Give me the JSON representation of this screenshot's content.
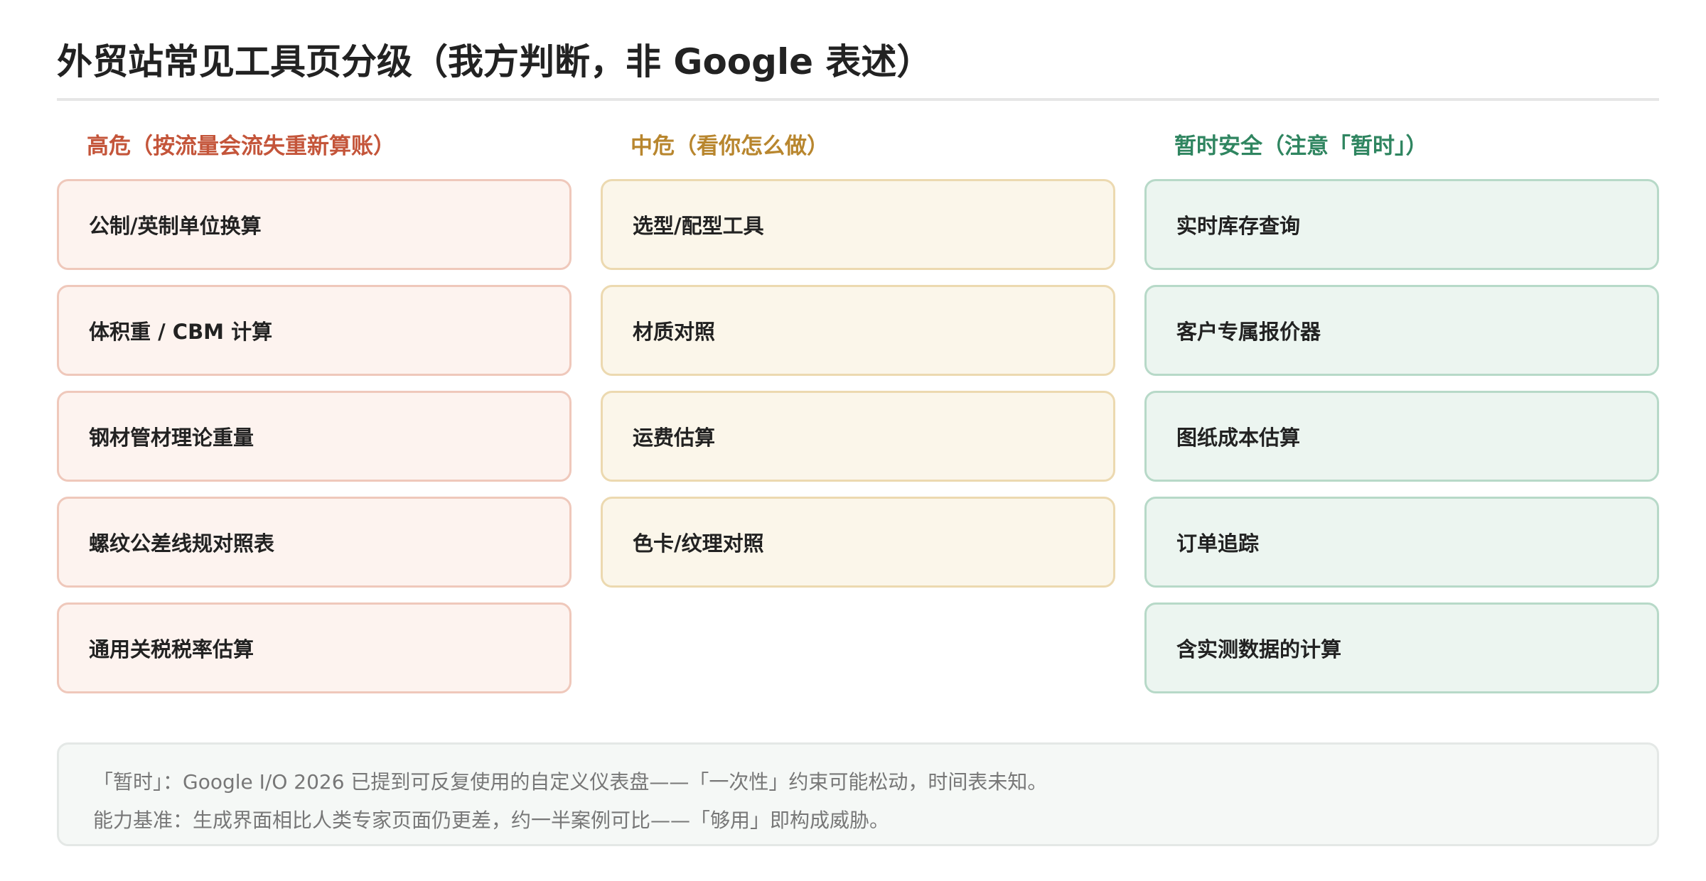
{
  "title": "外贸站常见工具页分级（我方判断，非 Google 表述）",
  "colors": {
    "high": {
      "heading": "#c4553a",
      "card_bg": "#fdf3ef",
      "card_border": "#efc8bb"
    },
    "medium": {
      "heading": "#b8862e",
      "card_bg": "#fbf6ea",
      "card_border": "#ecd9b0"
    },
    "safe": {
      "heading": "#2f8560",
      "card_bg": "#ecf5f0",
      "card_border": "#b7d9c8"
    }
  },
  "columns": [
    {
      "key": "high",
      "heading": "高危（按流量会流失重新算账）",
      "items": [
        "公制/英制单位换算",
        "体积重 / CBM 计算",
        "钢材管材理论重量",
        "螺纹公差线规对照表",
        "通用关税税率估算"
      ]
    },
    {
      "key": "medium",
      "heading": "中危（看你怎么做）",
      "items": [
        "选型/配型工具",
        "材质对照",
        "运费估算",
        "色卡/纹理对照"
      ]
    },
    {
      "key": "safe",
      "heading": "暂时安全（注意「暂时」）",
      "items": [
        "实时库存查询",
        "客户专属报价器",
        "图纸成本估算",
        "订单追踪",
        "含实测数据的计算"
      ]
    }
  ],
  "notes": [
    "「暂时」：Google I/O 2026 已提到可反复使用的自定义仪表盘——「一次性」约束可能松动，时间表未知。",
    "能力基准：生成界面相比人类专家页面仍更差，约一半案例可比——「够用」即构成威胁。"
  ]
}
